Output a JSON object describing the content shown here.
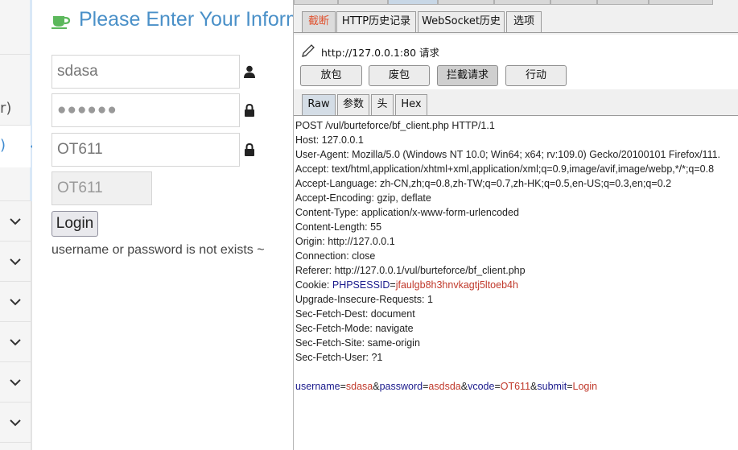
{
  "left_nav": {
    "frag_top": "r)",
    "frag_active": ")",
    "chevrons": 6
  },
  "webpage": {
    "title": "Please Enter Your Information",
    "username_value": "sdasa",
    "password_mask": "●●●●●●",
    "vcode_value": "OT611",
    "vcode_display": "OT611",
    "login_label": "Login",
    "error_message": "username or password is not exists ~"
  },
  "burp": {
    "tabs": [
      "截断",
      "HTTP历史记录",
      "WebSocket历史",
      "选项"
    ],
    "request_label": "http://127.0.0.1:80 请求",
    "actions": [
      "放包",
      "废包",
      "拦截请求",
      "行动"
    ],
    "view_tabs": [
      "Raw",
      "参数",
      "头",
      "Hex"
    ],
    "request_lines": [
      "POST /vul/burteforce/bf_client.php HTTP/1.1",
      "Host: 127.0.0.1",
      "User-Agent: Mozilla/5.0 (Windows NT 10.0; Win64; x64; rv:109.0) Gecko/20100101 Firefox/111.",
      "Accept: text/html,application/xhtml+xml,application/xml;q=0.9,image/avif,image/webp,*/*;q=0.8",
      "Accept-Language: zh-CN,zh;q=0.8,zh-TW;q=0.7,zh-HK;q=0.5,en-US;q=0.3,en;q=0.2",
      "Accept-Encoding: gzip, deflate",
      "Content-Type: application/x-www-form-urlencoded",
      "Content-Length: 55",
      "Origin: http://127.0.0.1",
      "Connection: close",
      "Referer: http://127.0.0.1/vul/burteforce/bf_client.php"
    ],
    "cookie": {
      "prefix": "Cookie: ",
      "name": "PHPSESSID",
      "eq": "=",
      "value": "jfaulgb8h3hnvkagtj5ltoeb4h"
    },
    "request_lines2": [
      "Upgrade-Insecure-Requests: 1",
      "Sec-Fetch-Dest: document",
      "Sec-Fetch-Mode: navigate",
      "Sec-Fetch-Site: same-origin",
      "Sec-Fetch-User: ?1"
    ],
    "body_params": [
      {
        "key": "username",
        "value": "sdasa"
      },
      {
        "key": "password",
        "value": "asdsda"
      },
      {
        "key": "vcode",
        "value": "OT611"
      },
      {
        "key": "submit",
        "value": "Login"
      }
    ],
    "colors": {
      "selected_tab_text": "#e0522f",
      "param_key": "#1a1a8c",
      "param_value": "#c0392b"
    }
  }
}
